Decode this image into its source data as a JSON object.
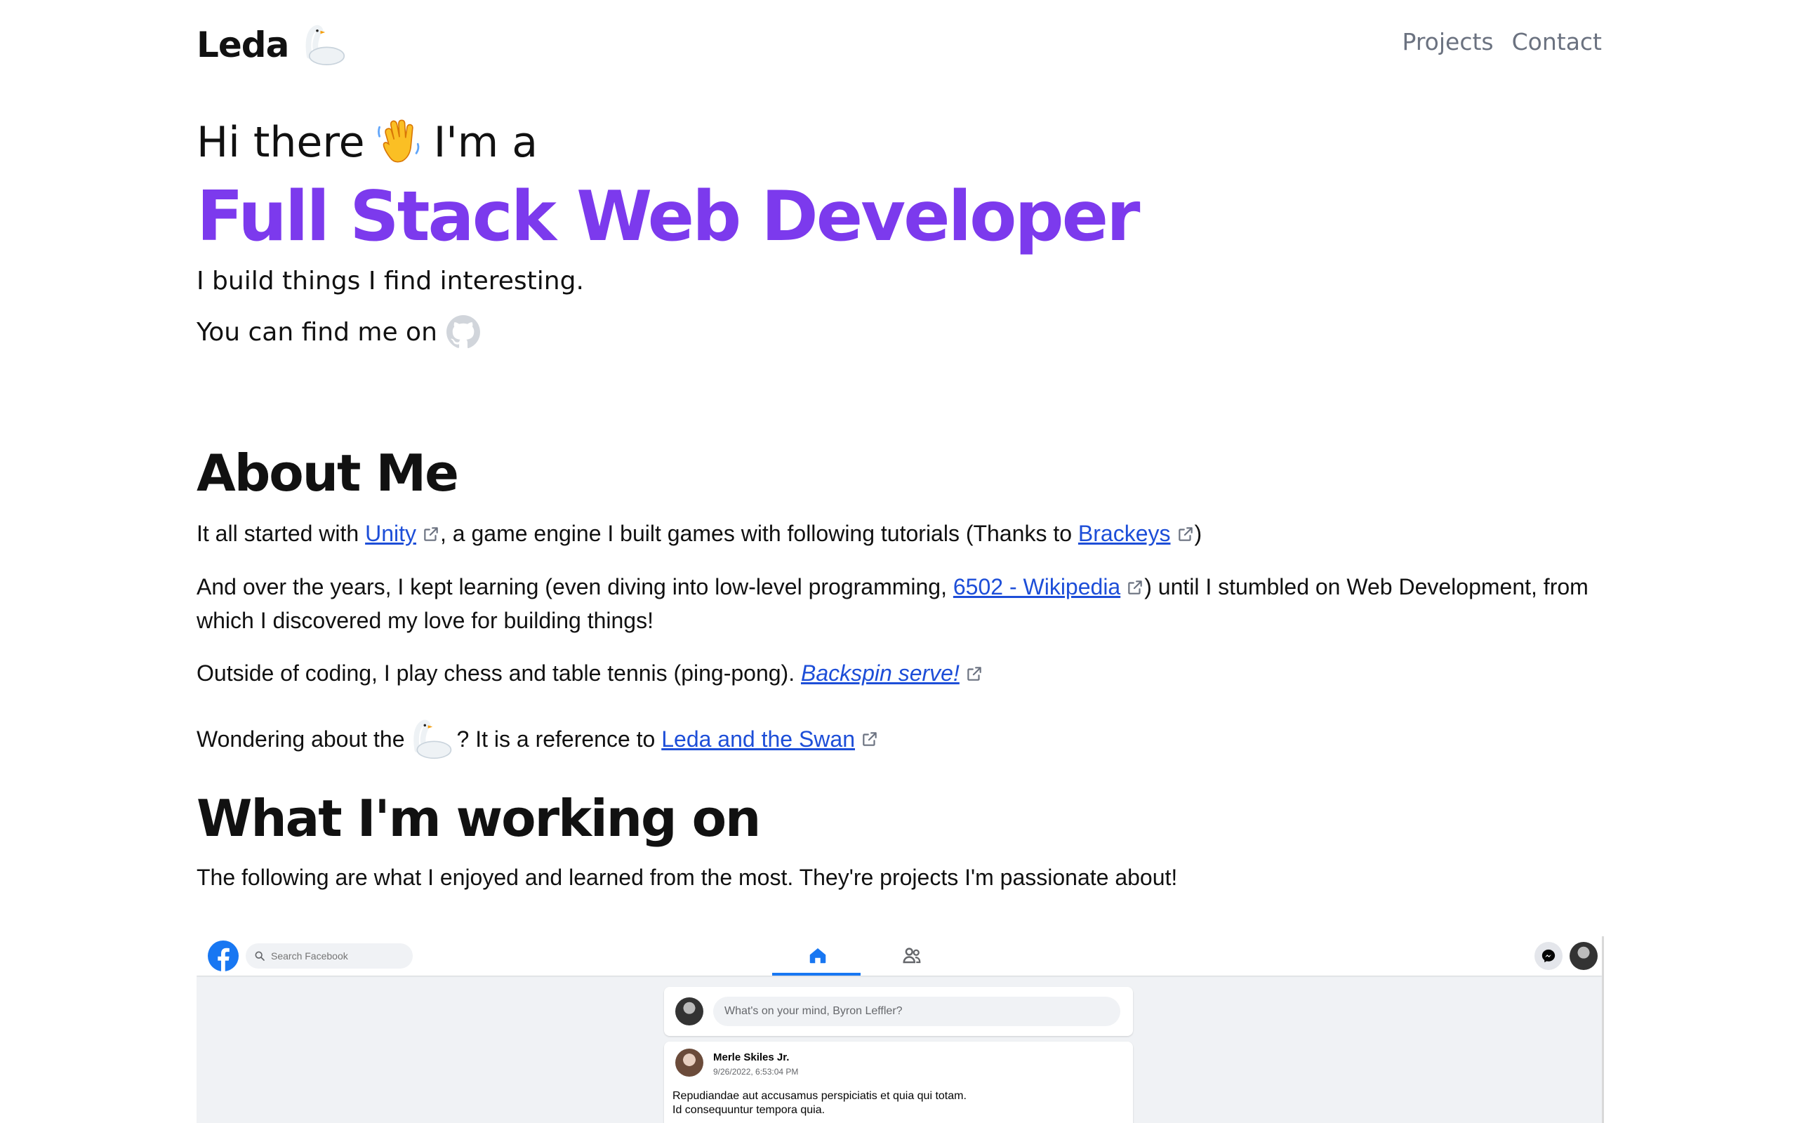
{
  "header": {
    "brand": "Leda",
    "nav": [
      "Projects",
      "Contact"
    ]
  },
  "hero": {
    "greeting_start": "Hi there",
    "greeting_end": "I'm a",
    "title": "Full Stack Web Developer",
    "subtitle": "I build things I find interesting.",
    "find_me": "You can find me on",
    "accent_color": "#7c3aed"
  },
  "about": {
    "heading": "About Me",
    "p1": {
      "before": "It all started with ",
      "link1": "Unity",
      "middle": ", a game engine I built games with following tutorials (Thanks to ",
      "link2": "Brackeys",
      "after": ")"
    },
    "p2": {
      "before": "And over the years, I kept learning (even diving into low-level programming, ",
      "link": "6502 - Wikipedia",
      "after": ") until I stumbled on Web Development, from which I discovered my love for building things!"
    },
    "p3": {
      "before": "Outside of coding, I play chess and table tennis (ping-pong). ",
      "link": "Backspin serve!"
    },
    "p4": {
      "before": "Wondering about the",
      "middle": "? It is a reference to ",
      "link": "Leda and the Swan"
    }
  },
  "work": {
    "heading": "What I'm working on",
    "intro": "The following are what I enjoyed and learned from the most. They're projects I'm passionate about!"
  },
  "project_preview": {
    "search_placeholder": "Search Facebook",
    "compose_placeholder": "What's on your mind, Byron Leffler?",
    "post_author": "Merle Skiles Jr.",
    "post_time": "9/26/2022, 6:53:04 PM",
    "post_line1": "Repudiandae aut accusamus perspiciatis et quia qui totam.",
    "post_line2": "Id consequuntur tempora quia."
  },
  "icons": [
    "swan-icon",
    "waving-hand-icon",
    "github-icon",
    "external-link-icon",
    "facebook-logo-icon",
    "search-icon",
    "home-icon",
    "friends-icon",
    "messenger-icon"
  ],
  "colors": {
    "link": "#1d4ed8",
    "nav": "#6b7280",
    "facebook_blue": "#1877f2"
  }
}
